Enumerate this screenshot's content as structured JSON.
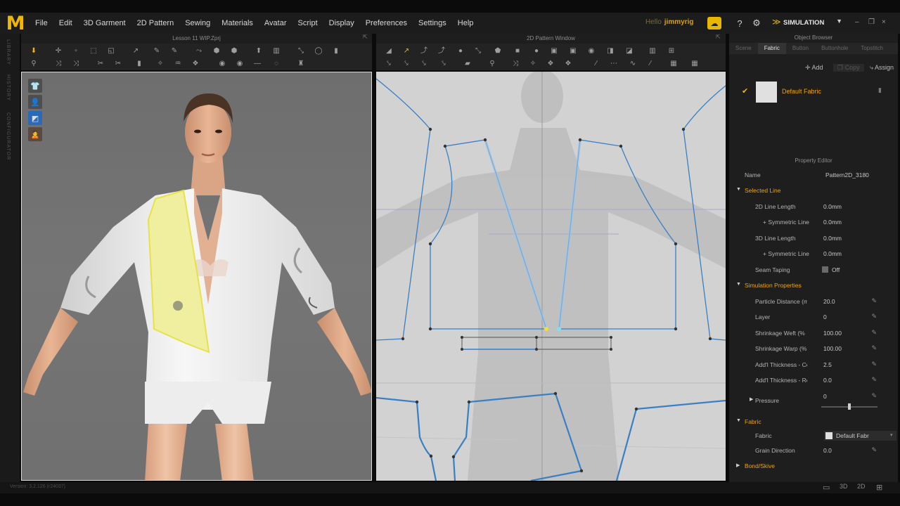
{
  "app": {
    "logo": "M",
    "menu": [
      "File",
      "Edit",
      "3D Garment",
      "2D Pattern",
      "Sewing",
      "Materials",
      "Avatar",
      "Script",
      "Display",
      "Preferences",
      "Settings",
      "Help"
    ],
    "user_prefix": "Hello",
    "user_name": "jimmyrig",
    "mode_label": "SIMULATION",
    "version": "Version: 3.2.126  (r24037)"
  },
  "left_rail": [
    "LIBRARY",
    "HISTORY",
    "CONFIGURATOR"
  ],
  "view3d": {
    "title": "Lesson 11 WIP.Zprj"
  },
  "view2d": {
    "title": "2D Pattern Window"
  },
  "object_browser": {
    "title": "Object Browser",
    "tabs": [
      "Scene",
      "Fabric",
      "Button",
      "Buttonhole",
      "Topstitch"
    ],
    "active_tab": "Fabric",
    "add_label": "Add",
    "copy_label": "Copy",
    "assign_label": "Assign",
    "fabric_name": "Default Fabric"
  },
  "property_editor": {
    "title": "Property Editor",
    "name_key": "Name",
    "name_value": "Pattern2D_3180",
    "sections": {
      "selected_line": "Selected Line",
      "simulation": "Simulation Properties",
      "fabric": "Fabric",
      "bond": "Bond/Skive"
    },
    "selected_line_rows": [
      {
        "k": "2D Line Length",
        "v": "0.0mm"
      },
      {
        "k": "+ Symmetric Line Le",
        "v": "0.0mm"
      },
      {
        "k": "3D Line Length",
        "v": "0.0mm"
      },
      {
        "k": "+ Symmetric Line Le",
        "v": "0.0mm"
      }
    ],
    "seam_taping": {
      "k": "Seam Taping",
      "v": "Off"
    },
    "simulation_rows": [
      {
        "k": "Particle Distance (m",
        "v": "20.0"
      },
      {
        "k": "Layer",
        "v": "0"
      },
      {
        "k": "Shrinkage Weft (%",
        "v": "100.00"
      },
      {
        "k": "Shrinkage Warp (%",
        "v": "100.00"
      },
      {
        "k": "Add'l Thickness - Collisic",
        "v": "2.5"
      },
      {
        "k": "Add'l Thickness - Render",
        "v": "0.0"
      }
    ],
    "pressure": {
      "k": "Pressure",
      "v": "0"
    },
    "fabric_rows": [
      {
        "k": "Fabric",
        "v": "Default Fabr"
      },
      {
        "k": "Grain Direction",
        "v": "0.0"
      }
    ]
  },
  "colors": {
    "accent": "#f2b600",
    "pattern_line": "#3a7fc4",
    "selected_fabric": "#f0efa0"
  }
}
